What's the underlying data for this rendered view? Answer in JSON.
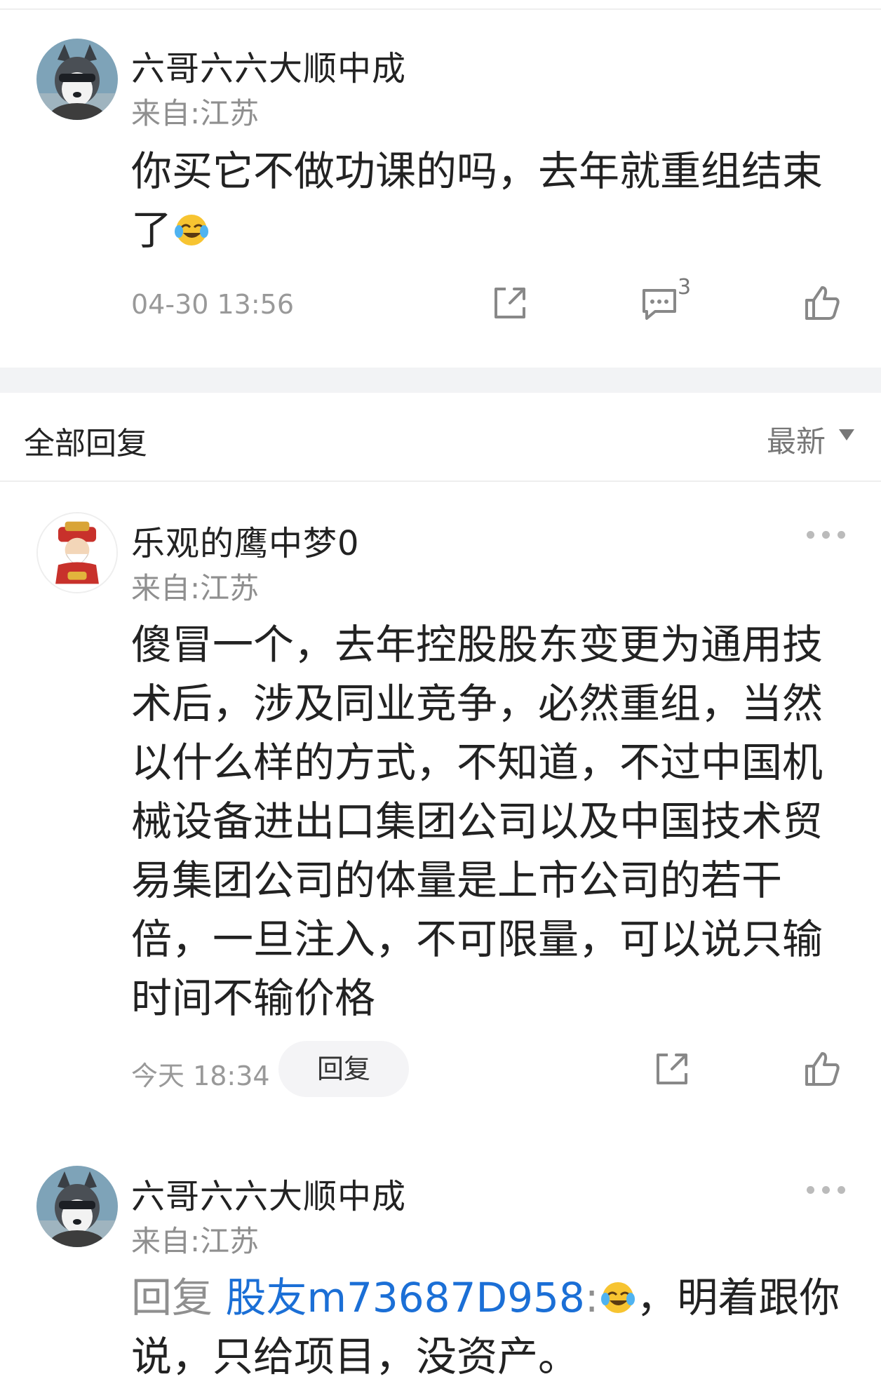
{
  "main_post": {
    "username": "六哥六六大顺中成",
    "location": "来自:江苏",
    "content_line1": "你买它不做功课的吗，去年就重组结束",
    "content_line2": "了",
    "emoji_icon": "laughing-crying-emoji-icon",
    "timestamp": "04-30 13:56",
    "comment_count": "3",
    "icons": [
      "share-icon",
      "comment-icon",
      "like-icon"
    ]
  },
  "replies_header": {
    "title": "全部回复",
    "sort_label": "最新"
  },
  "replies": [
    {
      "username": "乐观的鹰中梦0",
      "location": "来自:江苏",
      "lines": [
        "傻冒一个，去年控股股东变更为通用技",
        "术后，涉及同业竞争，必然重组，当然",
        "以什么样的方式，不知道，不过中国机",
        "械设备进出口集团公司以及中国技术贸",
        "易集团公司的体量是上市公司的若干",
        "倍，一旦注入，不可限量，可以说只输",
        "时间不输价格"
      ],
      "timestamp": "今天 18:34",
      "reply_button": "回复"
    },
    {
      "username": "六哥六六大顺中成",
      "location": "来自:江苏",
      "reply_prefix": "回复",
      "reply_target": "股友m73687D958",
      "colon": ":",
      "line1_rest": "，明着跟你",
      "line2": "说，只给项目，没资产。"
    }
  ],
  "colors": {
    "link": "#1b6fd6",
    "muted": "#8f8f8f",
    "separator": "#f2f3f5"
  }
}
